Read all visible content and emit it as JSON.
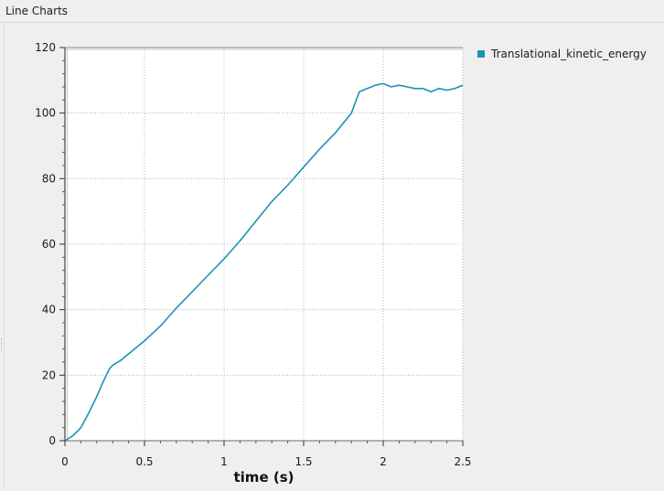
{
  "window": {
    "title": "Line Charts"
  },
  "colors": {
    "series": "#1b93b6",
    "plot_bg": "#ffffff",
    "grid": "#a8a8a8"
  },
  "chart_data": {
    "type": "line",
    "title": "",
    "xlabel": "time (s)",
    "ylabel": "",
    "xlim": [
      0,
      2.5
    ],
    "ylim": [
      0,
      120
    ],
    "xticks": [
      0,
      0.5,
      1,
      1.5,
      2,
      2.5
    ],
    "xtick_labels": [
      "0",
      "0.5",
      "1",
      "1.5",
      "2",
      "2.5"
    ],
    "yticks": [
      0,
      20,
      40,
      60,
      80,
      100,
      120
    ],
    "ytick_labels": [
      "0",
      "20",
      "40",
      "60",
      "80",
      "100",
      "120"
    ],
    "grid": true,
    "legend_position": "right",
    "series": [
      {
        "name": "Translational_kinetic_energy",
        "x": [
          0,
          0.05,
          0.1,
          0.15,
          0.2,
          0.25,
          0.28,
          0.3,
          0.35,
          0.4,
          0.45,
          0.5,
          0.6,
          0.7,
          0.8,
          0.9,
          1.0,
          1.1,
          1.2,
          1.3,
          1.4,
          1.5,
          1.6,
          1.7,
          1.8,
          1.85,
          1.9,
          1.95,
          2.0,
          2.05,
          2.1,
          2.15,
          2.2,
          2.25,
          2.3,
          2.35,
          2.4,
          2.45,
          2.5
        ],
        "y": [
          0,
          1.5,
          4.0,
          8.5,
          13.5,
          19.0,
          22.0,
          23.0,
          24.5,
          26.5,
          28.5,
          30.5,
          35.0,
          40.5,
          45.5,
          50.5,
          55.5,
          61.0,
          67.0,
          73.0,
          78.0,
          83.5,
          89.0,
          94.0,
          100.0,
          106.5,
          107.5,
          108.5,
          109.0,
          108.0,
          108.5,
          108.0,
          107.5,
          107.5,
          106.5,
          107.5,
          107.0,
          107.5,
          108.5
        ]
      }
    ]
  }
}
